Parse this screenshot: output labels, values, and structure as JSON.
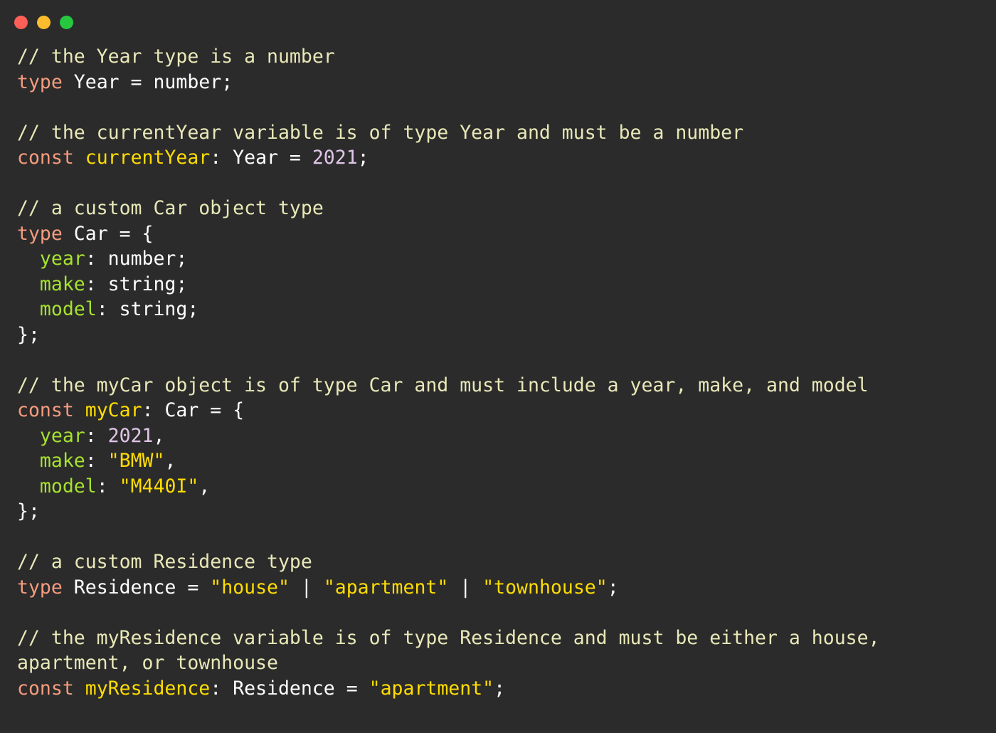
{
  "window": {
    "title": "",
    "background_color": "#2B2B2B",
    "traffic_lights": [
      {
        "name": "close",
        "color": "#FF5F57"
      },
      {
        "name": "minimize",
        "color": "#FDBC2E"
      },
      {
        "name": "maximize",
        "color": "#27C83F"
      }
    ]
  },
  "theme": {
    "comment": "#E8E8B8",
    "keyword": "#F69C7F",
    "identifier": "#FFDD00",
    "property": "#A6E22E",
    "string": "#FFDD00",
    "number": "#E0C6E8",
    "plain": "#FFFFFF"
  },
  "code": {
    "language": "typescript",
    "lines": [
      {
        "n": 1,
        "tokens": [
          {
            "t": "// the Year type is a number",
            "c": "comment"
          }
        ]
      },
      {
        "n": 2,
        "tokens": [
          {
            "t": "type",
            "c": "keyword"
          },
          {
            "t": " Year = number;",
            "c": "plain"
          }
        ]
      },
      {
        "n": 3,
        "tokens": []
      },
      {
        "n": 4,
        "tokens": [
          {
            "t": "// the currentYear variable is of type Year and must be a number",
            "c": "comment"
          }
        ]
      },
      {
        "n": 5,
        "tokens": [
          {
            "t": "const",
            "c": "keyword"
          },
          {
            "t": " ",
            "c": "plain"
          },
          {
            "t": "currentYear",
            "c": "identifier"
          },
          {
            "t": ": Year = ",
            "c": "plain"
          },
          {
            "t": "2021",
            "c": "number"
          },
          {
            "t": ";",
            "c": "plain"
          }
        ]
      },
      {
        "n": 6,
        "tokens": []
      },
      {
        "n": 7,
        "tokens": [
          {
            "t": "// a custom Car object type",
            "c": "comment"
          }
        ]
      },
      {
        "n": 8,
        "tokens": [
          {
            "t": "type",
            "c": "keyword"
          },
          {
            "t": " Car = {",
            "c": "plain"
          }
        ]
      },
      {
        "n": 9,
        "tokens": [
          {
            "t": "  ",
            "c": "plain"
          },
          {
            "t": "year",
            "c": "property"
          },
          {
            "t": ": number;",
            "c": "plain"
          }
        ]
      },
      {
        "n": 10,
        "tokens": [
          {
            "t": "  ",
            "c": "plain"
          },
          {
            "t": "make",
            "c": "property"
          },
          {
            "t": ": string;",
            "c": "plain"
          }
        ]
      },
      {
        "n": 11,
        "tokens": [
          {
            "t": "  ",
            "c": "plain"
          },
          {
            "t": "model",
            "c": "property"
          },
          {
            "t": ": string;",
            "c": "plain"
          }
        ]
      },
      {
        "n": 12,
        "tokens": [
          {
            "t": "};",
            "c": "plain"
          }
        ]
      },
      {
        "n": 13,
        "tokens": []
      },
      {
        "n": 14,
        "tokens": [
          {
            "t": "// the myCar object is of type Car and must include a year, make, and model",
            "c": "comment"
          }
        ]
      },
      {
        "n": 15,
        "tokens": [
          {
            "t": "const",
            "c": "keyword"
          },
          {
            "t": " ",
            "c": "plain"
          },
          {
            "t": "myCar",
            "c": "identifier"
          },
          {
            "t": ": Car = {",
            "c": "plain"
          }
        ]
      },
      {
        "n": 16,
        "tokens": [
          {
            "t": "  ",
            "c": "plain"
          },
          {
            "t": "year",
            "c": "property"
          },
          {
            "t": ": ",
            "c": "plain"
          },
          {
            "t": "2021",
            "c": "number"
          },
          {
            "t": ",",
            "c": "plain"
          }
        ]
      },
      {
        "n": 17,
        "tokens": [
          {
            "t": "  ",
            "c": "plain"
          },
          {
            "t": "make",
            "c": "property"
          },
          {
            "t": ": ",
            "c": "plain"
          },
          {
            "t": "\"BMW\"",
            "c": "string"
          },
          {
            "t": ",",
            "c": "plain"
          }
        ]
      },
      {
        "n": 18,
        "tokens": [
          {
            "t": "  ",
            "c": "plain"
          },
          {
            "t": "model",
            "c": "property"
          },
          {
            "t": ": ",
            "c": "plain"
          },
          {
            "t": "\"M440I\"",
            "c": "string"
          },
          {
            "t": ",",
            "c": "plain"
          }
        ]
      },
      {
        "n": 19,
        "tokens": [
          {
            "t": "};",
            "c": "plain"
          }
        ]
      },
      {
        "n": 20,
        "tokens": []
      },
      {
        "n": 21,
        "tokens": [
          {
            "t": "// a custom Residence type",
            "c": "comment"
          }
        ]
      },
      {
        "n": 22,
        "tokens": [
          {
            "t": "type",
            "c": "keyword"
          },
          {
            "t": " Residence = ",
            "c": "plain"
          },
          {
            "t": "\"house\"",
            "c": "string"
          },
          {
            "t": " | ",
            "c": "plain"
          },
          {
            "t": "\"apartment\"",
            "c": "string"
          },
          {
            "t": " | ",
            "c": "plain"
          },
          {
            "t": "\"townhouse\"",
            "c": "string"
          },
          {
            "t": ";",
            "c": "plain"
          }
        ]
      },
      {
        "n": 23,
        "tokens": []
      },
      {
        "n": 24,
        "tokens": [
          {
            "t": "// the myResidence variable is of type Residence and must be either a house, apartment, or townhouse",
            "c": "comment"
          }
        ]
      },
      {
        "n": 25,
        "tokens": [
          {
            "t": "const",
            "c": "keyword"
          },
          {
            "t": " ",
            "c": "plain"
          },
          {
            "t": "myResidence",
            "c": "identifier"
          },
          {
            "t": ": Residence = ",
            "c": "plain"
          },
          {
            "t": "\"apartment\"",
            "c": "string"
          },
          {
            "t": ";",
            "c": "plain"
          }
        ]
      }
    ],
    "plain_text": "// the Year type is a number\ntype Year = number;\n\n// the currentYear variable is of type Year and must be a number\nconst currentYear: Year = 2021;\n\n// a custom Car object type\ntype Car = {\n  year: number;\n  make: string;\n  model: string;\n};\n\n// the myCar object is of type Car and must include a year, make, and model\nconst myCar: Car = {\n  year: 2021,\n  make: \"BMW\",\n  model: \"M440I\",\n};\n\n// a custom Residence type\ntype Residence = \"house\" | \"apartment\" | \"townhouse\";\n\n// the myResidence variable is of type Residence and must be either a house, apartment, or townhouse\nconst myResidence: Residence = \"apartment\";"
  }
}
